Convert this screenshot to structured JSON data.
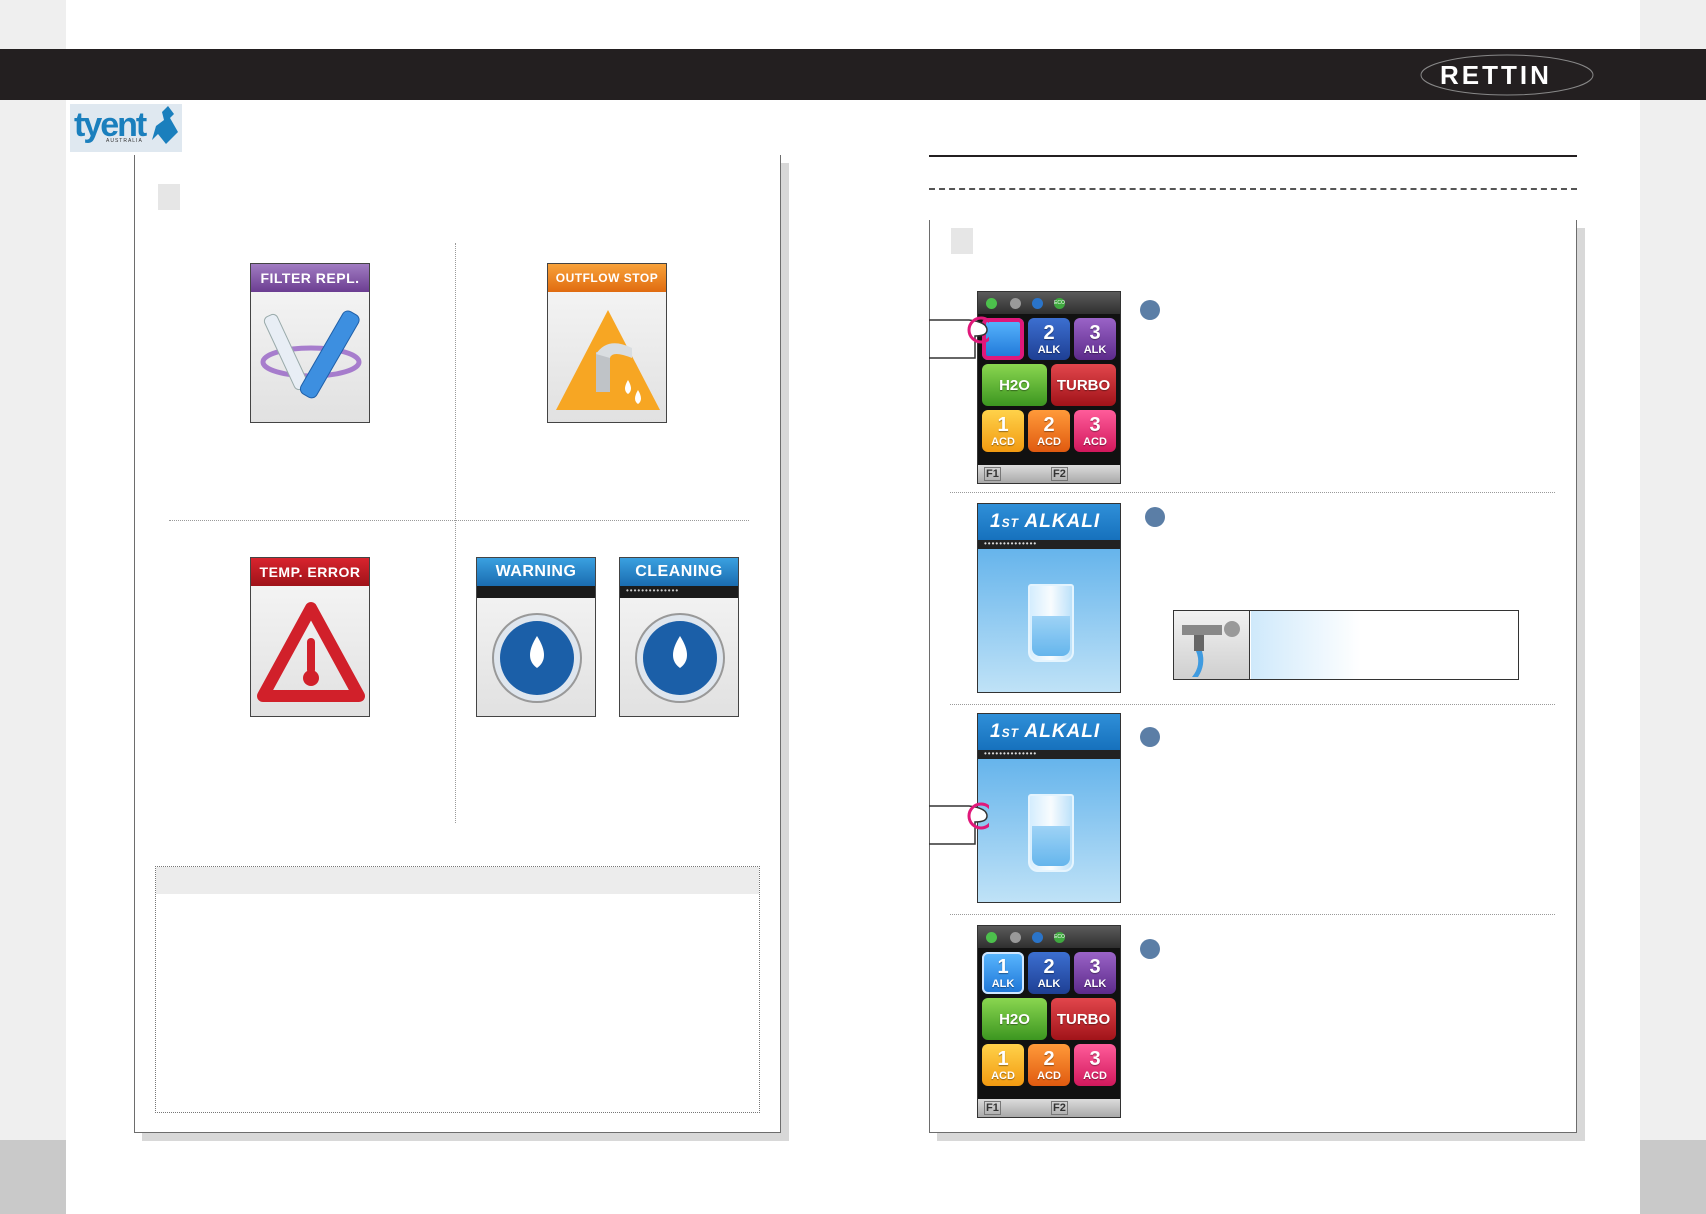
{
  "brand": {
    "name": "RETTIN",
    "company": "tyent",
    "company_sub": "AUSTRALIA"
  },
  "left": {
    "cards": [
      {
        "label": "FILTER REPL."
      },
      {
        "label": "OUTFLOW STOP"
      },
      {
        "label": "TEMP. ERROR"
      },
      {
        "label": "WARNING"
      },
      {
        "label": "CLEANING"
      }
    ]
  },
  "screen": {
    "status_eco": "ECO",
    "buttons": {
      "alk1_n": "1",
      "alk1_s": "ALK",
      "alk2_n": "2",
      "alk2_s": "ALK",
      "alk3_n": "3",
      "alk3_s": "ALK",
      "h2o": "H2O",
      "turbo": "TURBO",
      "acd1_n": "1",
      "acd1_s": "ACD",
      "acd2_n": "2",
      "acd2_s": "ACD",
      "acd3_n": "3",
      "acd3_s": "ACD"
    },
    "f1": "F1",
    "f2": "F2",
    "alkali_num": "1",
    "alkali_sup": "ST",
    "alkali_word": "ALKALI",
    "alkali_dots": "••••••••••••••"
  },
  "colors": {
    "topbar": "#231f20",
    "accent_blue": "#1a7fbd",
    "step_dot": "#5b7ea6"
  }
}
